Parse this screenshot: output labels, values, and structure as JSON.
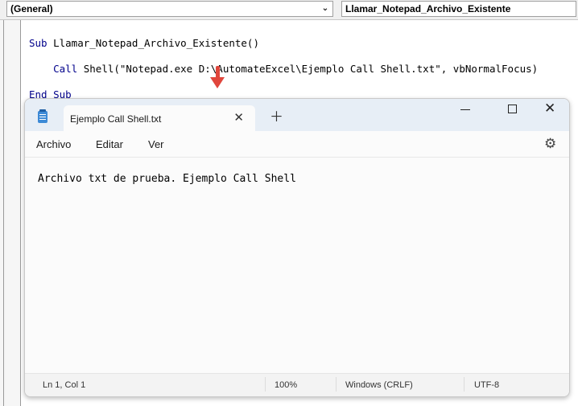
{
  "vba": {
    "general_combo": "(General)",
    "procedure_combo": "Llamar_Notepad_Archivo_Existente",
    "code": {
      "line1_kw": "Sub",
      "line1_text": " Llamar_Notepad_Archivo_Existente()",
      "line2_kw": "Call",
      "line2_text": " Shell(\"Notepad.exe D:\\AutomateExcel\\Ejemplo Call Shell.txt\", vbNormalFocus)",
      "line3_kw": "End Sub"
    }
  },
  "notepad": {
    "tab_title": "Ejemplo Call Shell.txt",
    "menu": [
      "Archivo",
      "Editar",
      "Ver"
    ],
    "body_text": "Archivo txt de prueba. Ejemplo Call Shell",
    "status": {
      "position": "Ln 1, Col 1",
      "zoom": "100%",
      "line_ending": "Windows (CRLF)",
      "encoding": "UTF-8"
    }
  },
  "colors": {
    "arrow": "#e0463c",
    "vba_keyword": "#00008b"
  }
}
